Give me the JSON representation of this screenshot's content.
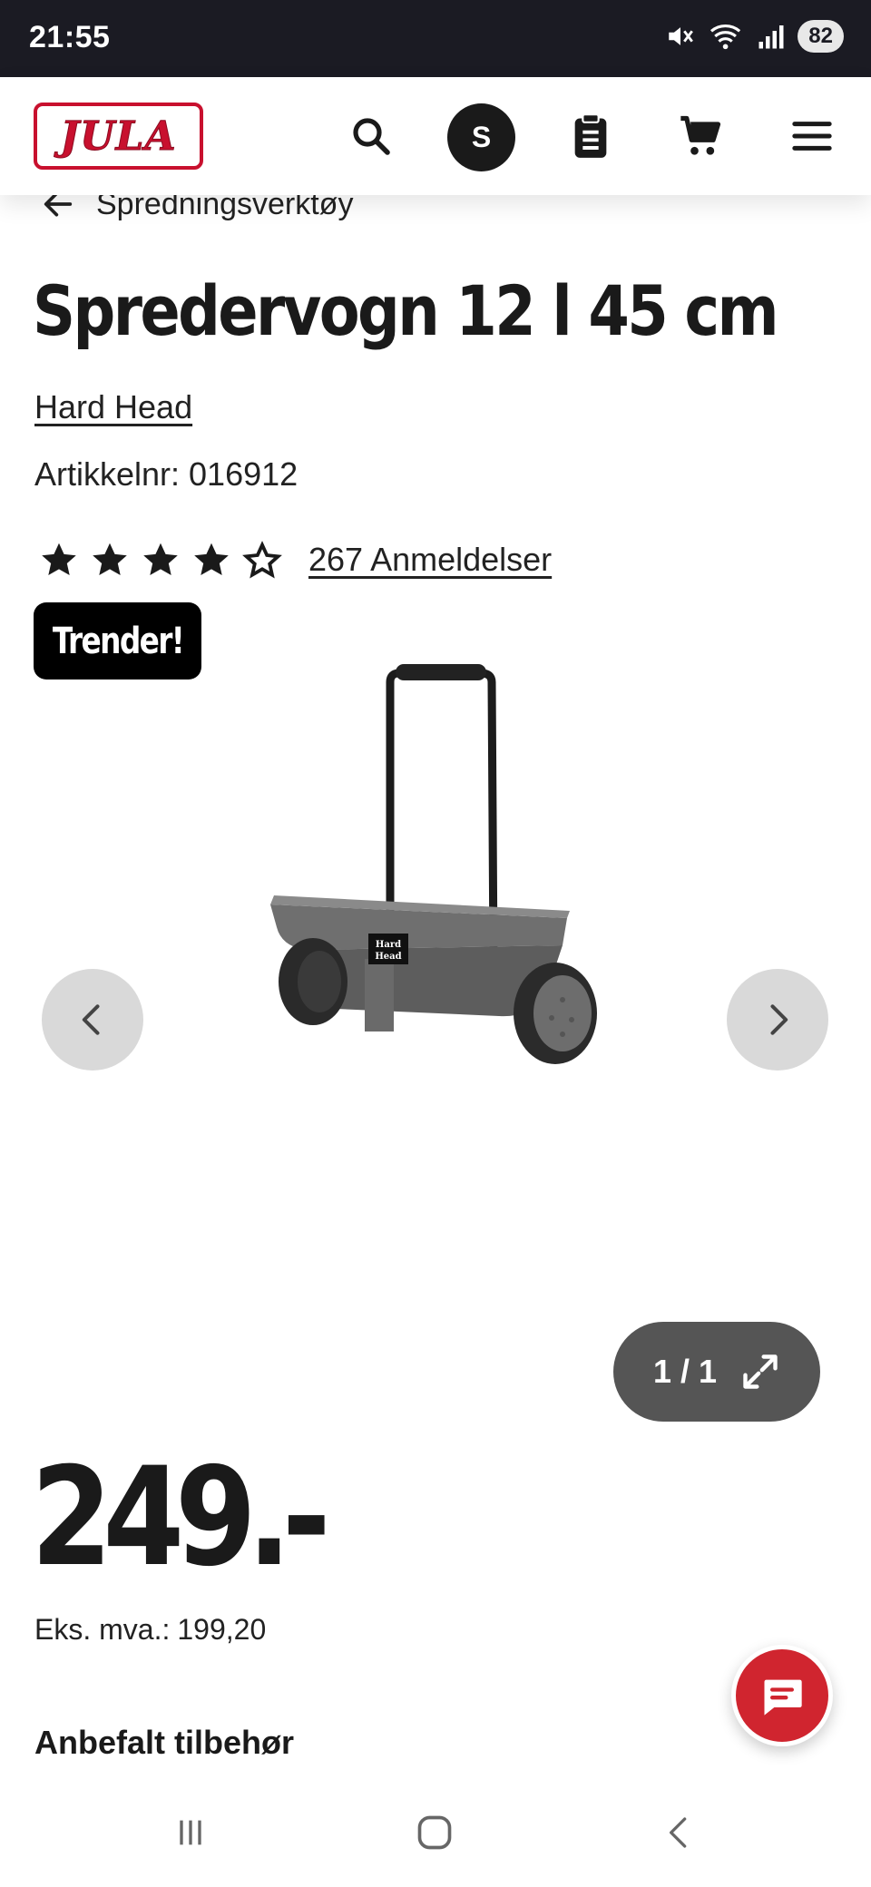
{
  "status_bar": {
    "time": "21:55",
    "battery": "82",
    "wifi_label": "6"
  },
  "header": {
    "logo_text": "JULA",
    "avatar_initial": "S"
  },
  "breadcrumb": {
    "label": "Spredningsverktøy"
  },
  "product": {
    "title": "Spredervogn 12 l 45 cm",
    "brand": "Hard Head",
    "article_label": "Artikkelnr:",
    "article_number": "016912",
    "rating": 4.5,
    "reviews_label": "267 Anmeldelser",
    "badge": "Trender!"
  },
  "gallery": {
    "counter": "1 / 1",
    "image_brand_text": "Hard Head"
  },
  "price": {
    "value": "249.-",
    "ex_vat_label": "Eks. mva.:",
    "ex_vat_value": "199,20"
  },
  "recommended": {
    "title": "Anbefalt tilbehør"
  },
  "colors": {
    "brand_red": "#c8102e",
    "status_bar": "#1b1b23",
    "chat_red": "#d0252f",
    "counter_bg": "#555555"
  },
  "icons": {
    "header": [
      "search-icon",
      "clipboard-icon",
      "cart-icon",
      "menu-icon"
    ],
    "gallery": [
      "chevron-left-icon",
      "chevron-right-icon",
      "expand-icon"
    ],
    "chat": "chat-icon",
    "system_nav": [
      "recents-icon",
      "home-icon",
      "back-icon"
    ]
  }
}
